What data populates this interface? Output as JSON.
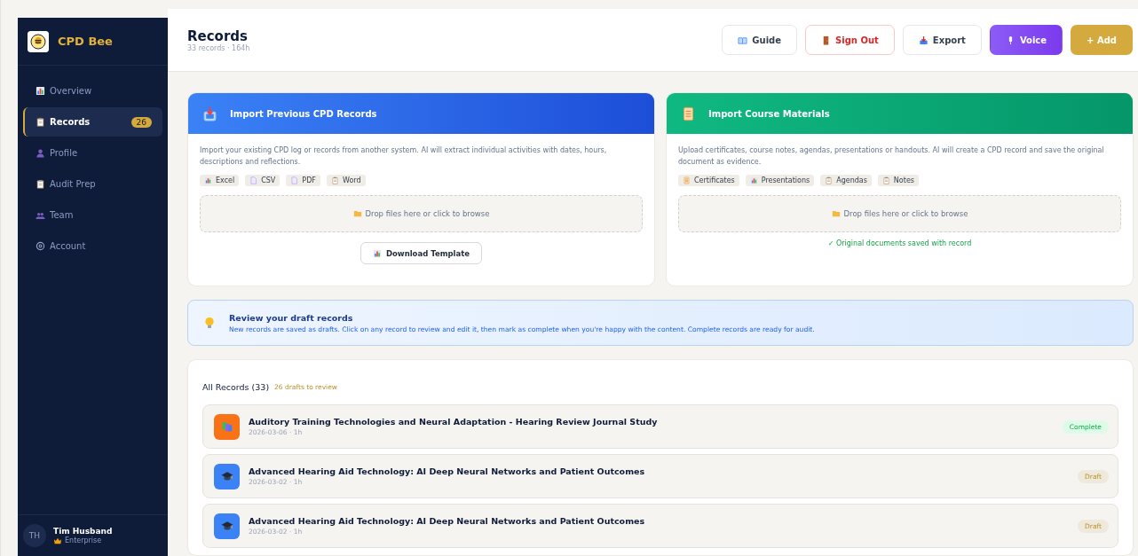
{
  "brand": {
    "name": "CPD Bee"
  },
  "sidebar": {
    "items": [
      {
        "label": "Overview",
        "selected": false
      },
      {
        "label": "Records",
        "selected": true,
        "badge": "26"
      },
      {
        "label": "Profile",
        "selected": false
      },
      {
        "label": "Audit Prep",
        "selected": false
      },
      {
        "label": "Team",
        "selected": false
      },
      {
        "label": "Account",
        "selected": false
      }
    ],
    "user": {
      "initials": "TH",
      "name": "Tim Husband",
      "plan": "Enterprise"
    }
  },
  "header": {
    "title": "Records",
    "subtitle": "33 records · 164h",
    "buttons": [
      {
        "label": "Guide",
        "kind": "outline"
      },
      {
        "label": "Sign Out",
        "kind": "danger"
      },
      {
        "label": "Export",
        "kind": "outline"
      },
      {
        "label": "Voice",
        "kind": "voice"
      },
      {
        "label": "+ Add",
        "kind": "primary"
      }
    ]
  },
  "import_cards": [
    {
      "kind": "blue",
      "title": "Import Previous CPD Records",
      "description": "Import your existing CPD log or records from another system. AI will extract individual activities with dates, hours, descriptions and reflections.",
      "tags": [
        "Excel",
        "CSV",
        "PDF",
        "Word"
      ],
      "dropzone": "Drop files here or click to browse",
      "button": "Download Template"
    },
    {
      "kind": "green",
      "title": "Import Course Materials",
      "description": "Upload certificates, course notes, agendas, presentations or handouts. AI will create a CPD record and save the original document as evidence.",
      "tags": [
        "Certificates",
        "Presentations",
        "Agendas",
        "Notes"
      ],
      "dropzone": "Drop files here or click to browse",
      "note": "✓ Original documents saved with record"
    }
  ],
  "tip": {
    "title": "Review your draft records",
    "text": "New records are saved as drafts. Click on any record to review and edit it, then mark as complete when you're happy with the content. Complete records are ready for audit."
  },
  "records": {
    "title": "All Records (33)",
    "drafts": "26 drafts to review",
    "rows": [
      {
        "title": "Auditory Training Technologies and Neural Adaptation - Hearing Review Journal Study",
        "meta": "2026-03-06 · 1h",
        "color": "#f97316",
        "status": "Complete",
        "kind": "complete"
      },
      {
        "title": "Advanced Hearing Aid Technology: AI Deep Neural Networks and Patient Outcomes",
        "meta": "2026-03-02 · 1h",
        "color": "#3b82f6",
        "status": "Draft",
        "kind": "draft"
      },
      {
        "title": "Advanced Hearing Aid Technology: AI Deep Neural Networks and Patient Outcomes",
        "meta": "2026-03-02 · 1h",
        "color": "#3b82f6",
        "status": "Draft",
        "kind": "draft"
      }
    ]
  }
}
